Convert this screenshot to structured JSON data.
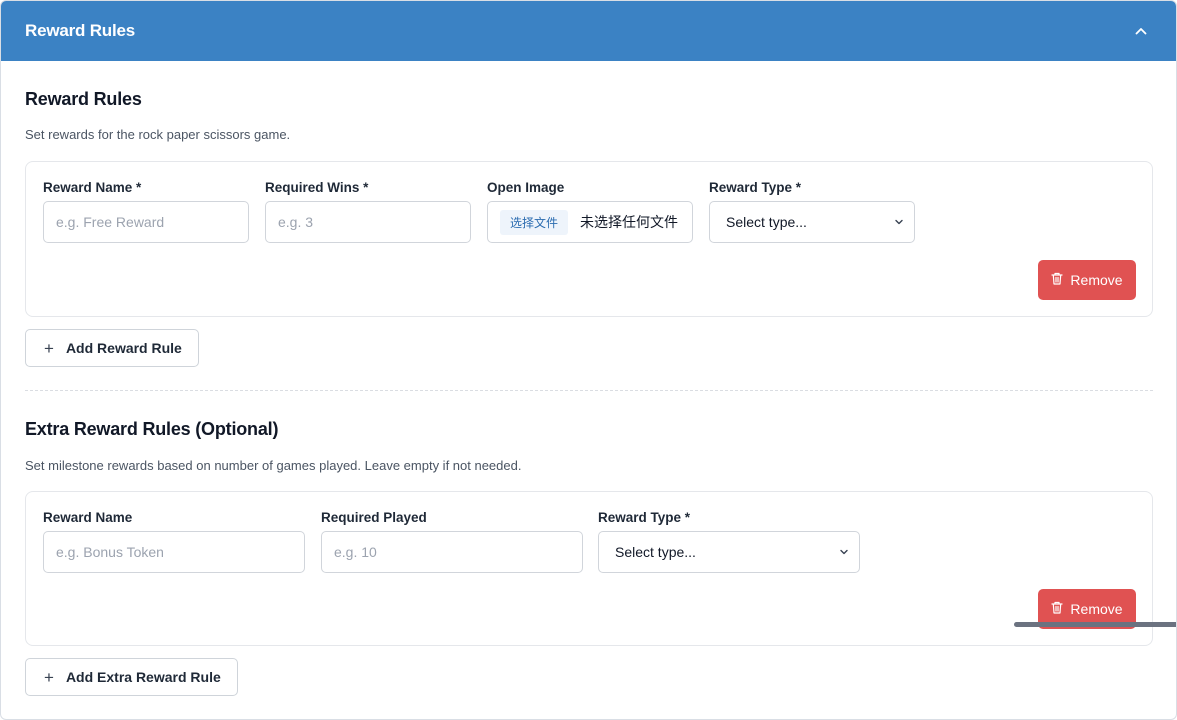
{
  "panel": {
    "title": "Reward Rules",
    "accent": "#3b82c4",
    "danger": "#e05252"
  },
  "reward_rules": {
    "title": "Reward Rules",
    "description": "Set rewards for the rock paper scissors game.",
    "fields": {
      "reward_name": {
        "label": "Reward Name *",
        "placeholder": "e.g. Free Reward",
        "value": ""
      },
      "required_wins": {
        "label": "Required Wins *",
        "placeholder": "e.g. 3",
        "value": ""
      },
      "open_image": {
        "label": "Open Image",
        "button_label": "选择文件",
        "status": "未选择任何文件"
      },
      "reward_type": {
        "label": "Reward Type *",
        "selected": "Select type..."
      }
    },
    "remove_label": "Remove",
    "add_label": "Add Reward Rule"
  },
  "extra_rules": {
    "title": "Extra Reward Rules (Optional)",
    "description": "Set milestone rewards based on number of games played. Leave empty if not needed.",
    "fields": {
      "reward_name": {
        "label": "Reward Name",
        "placeholder": "e.g. Bonus Token",
        "value": ""
      },
      "required_played": {
        "label": "Required Played",
        "placeholder": "e.g. 10",
        "value": ""
      },
      "reward_type": {
        "label": "Reward Type *",
        "selected": "Select type..."
      }
    },
    "remove_label": "Remove",
    "add_label": "Add Extra Reward Rule"
  }
}
